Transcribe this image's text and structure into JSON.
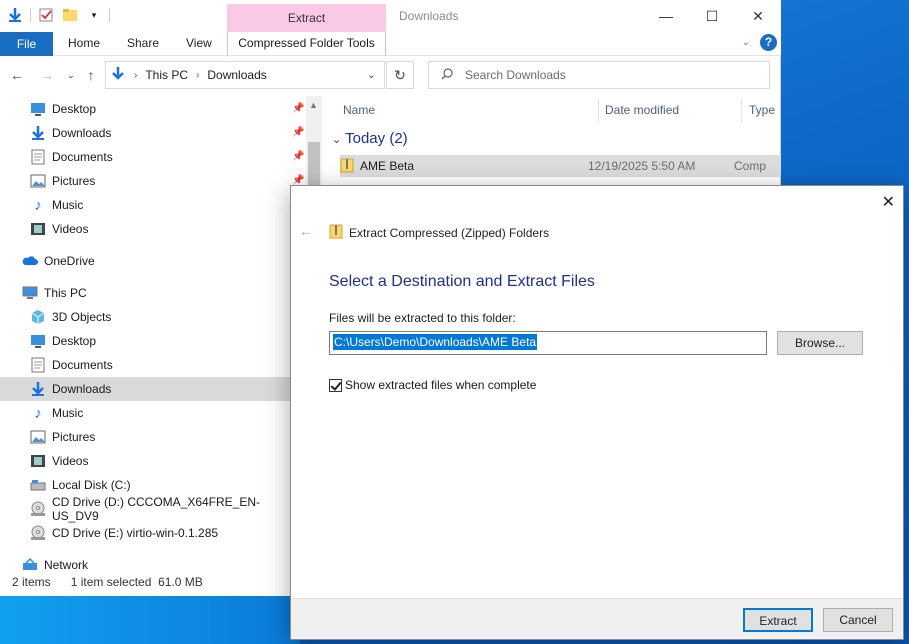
{
  "explorer": {
    "context_tab": "Extract",
    "title": "Downloads",
    "ribbon": {
      "file": "File",
      "home": "Home",
      "share": "Share",
      "view": "View",
      "compressed_tools": "Compressed Folder Tools"
    },
    "address": {
      "segments": [
        "This PC",
        "Downloads"
      ]
    },
    "search_placeholder": "Search Downloads",
    "nav": {
      "quick": [
        "Desktop",
        "Downloads",
        "Documents",
        "Pictures",
        "Music",
        "Videos"
      ],
      "onedrive": "OneDrive",
      "thispc": "This PC",
      "pc_items": [
        "3D Objects",
        "Desktop",
        "Documents",
        "Downloads",
        "Music",
        "Pictures",
        "Videos",
        "Local Disk (C:)",
        "CD Drive (D:) CCCOMA_X64FRE_EN-US_DV9",
        "CD Drive (E:) virtio-win-0.1.285"
      ],
      "network": "Network"
    },
    "columns": {
      "name": "Name",
      "date": "Date modified",
      "type": "Type"
    },
    "group": "Today (2)",
    "rows": [
      {
        "name": "AME Beta",
        "date": "12/19/2025 5:50 AM",
        "type": "Comp"
      }
    ],
    "status": {
      "items": "2 items",
      "selected": "1 item selected  61.0 MB"
    }
  },
  "dialog": {
    "title": "Extract Compressed (Zipped) Folders",
    "heading": "Select a Destination and Extract Files",
    "label": "Files will be extracted to this folder:",
    "path": "C:\\Users\\Demo\\Downloads\\AME Beta",
    "browse": "Browse...",
    "checkbox_label": "Show extracted files when complete",
    "extract": "Extract",
    "cancel": "Cancel"
  },
  "colors": {
    "accent": "#0078d7",
    "file_tab": "#1a6ec2",
    "context_tab": "#f9c9e6",
    "heading": "#1e3287"
  },
  "icons": {
    "folder": "folder-icon",
    "zip": "zip-folder-icon",
    "download": "download-arrow-icon",
    "pc": "computer-icon",
    "cloud": "onedrive-icon",
    "network": "network-icon",
    "drive": "disk-icon",
    "cd": "cd-drive-icon"
  }
}
